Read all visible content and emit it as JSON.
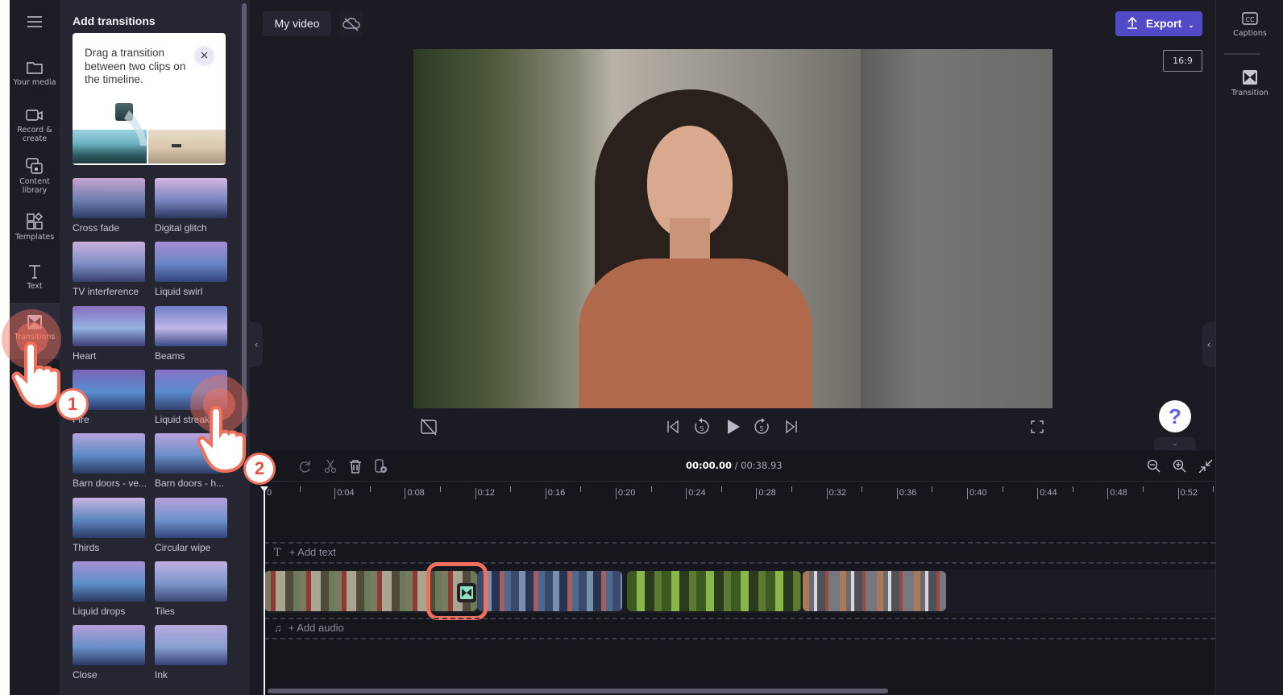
{
  "rail": {
    "items": [
      {
        "label": "Your media",
        "icon": "folder-icon"
      },
      {
        "label": "Record & create",
        "icon": "camera-icon"
      },
      {
        "label": "Content library",
        "icon": "content-library-icon"
      },
      {
        "label": "Templates",
        "icon": "templates-icon"
      },
      {
        "label": "Text",
        "icon": "text-icon"
      },
      {
        "label": "Transitions",
        "icon": "transitions-icon",
        "active": true
      }
    ]
  },
  "panel": {
    "title": "Add transitions",
    "tip": {
      "text": "Drag a transition between two clips on the timeline.",
      "close": "×"
    },
    "transitions": [
      "Cross fade",
      "Digital glitch",
      "TV interference",
      "Liquid swirl",
      "Heart",
      "Beams",
      "Fire",
      "Liquid streaks",
      "Barn doors - ve...",
      "Barn doors - h...",
      "Thirds",
      "Circular wipe",
      "Liquid drops",
      "Tiles",
      "Close",
      "Ink"
    ]
  },
  "header": {
    "project_title": "My video",
    "export_label": "Export",
    "aspect_ratio": "16:9"
  },
  "right_rail": {
    "items": [
      {
        "label": "Captions",
        "icon": "captions-icon"
      },
      {
        "label": "Transition",
        "icon": "transition-icon"
      }
    ]
  },
  "player": {
    "help": "?",
    "skip_back_seconds": "5",
    "skip_forward_seconds": "5"
  },
  "timeline": {
    "current_time": "00:00.00",
    "separator": " / ",
    "total_time": "00:38.93",
    "ticks": [
      "0",
      "0:04",
      "0:08",
      "0:12",
      "0:16",
      "0:20",
      "0:24",
      "0:28",
      "0:32",
      "0:36",
      "0:40",
      "0:44",
      "0:48",
      "0:52"
    ],
    "add_text": "+ Add text",
    "add_audio": "+ Add audio"
  },
  "annotations": {
    "step1": "1",
    "step2": "2"
  },
  "colors": {
    "accent": "#5249c7",
    "highlight": "#f0705e",
    "transition_marker": "#8fe0c0"
  }
}
